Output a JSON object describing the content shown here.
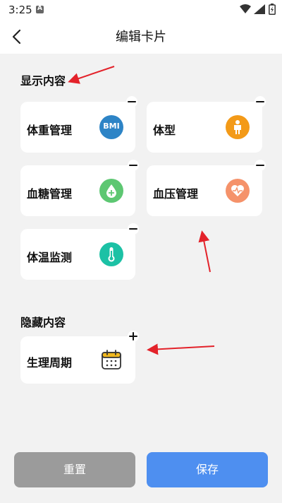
{
  "status_bar": {
    "time": "3:25"
  },
  "header": {
    "title": "编辑卡片"
  },
  "sections": {
    "shown_title": "显示内容",
    "hidden_title": "隐藏内容"
  },
  "shown_cards": [
    {
      "label": "体重管理",
      "icon": "bmi-icon",
      "icon_text": "BMI",
      "icon_color": "#2d84c6"
    },
    {
      "label": "体型",
      "icon": "body-shape-icon",
      "icon_color": "#f39a18"
    },
    {
      "label": "血糖管理",
      "icon": "blood-sugar-icon",
      "icon_color": "#5dc772"
    },
    {
      "label": "血压管理",
      "icon": "blood-pressure-icon",
      "icon_color": "#f5926a"
    },
    {
      "label": "体温监测",
      "icon": "thermometer-icon",
      "icon_color": "#1cc1a5"
    }
  ],
  "hidden_cards": [
    {
      "label": "生理周期",
      "icon": "calendar-icon",
      "icon_color": "#f1b81f"
    }
  ],
  "buttons": {
    "reset": "重置",
    "save": "保存"
  },
  "colors": {
    "accent": "#4e8ff0",
    "reset_bg": "#9b9b9b",
    "annotation_arrow": "#e3222a"
  }
}
